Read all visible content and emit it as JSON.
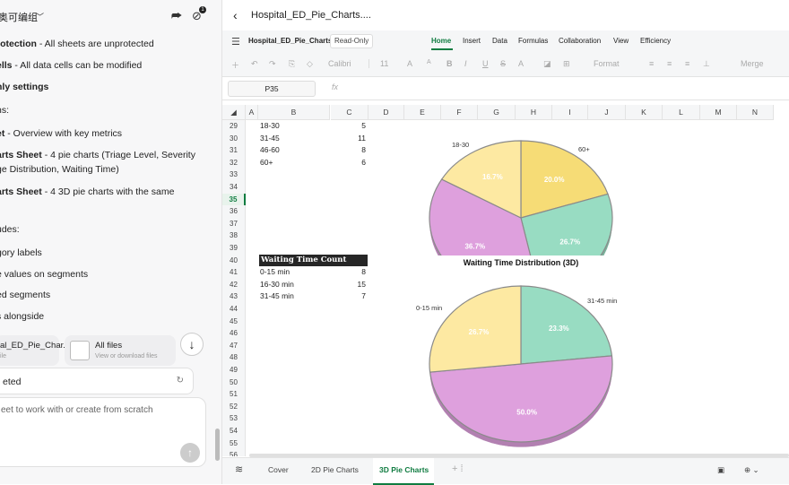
{
  "chat": {
    "title": "奥可编组",
    "title_caret": "﹀",
    "lines": [
      {
        "bold": "rotection",
        "rest": " - All sheets are unprotected"
      },
      {
        "bold": "ells",
        "rest": " - All data cells can be modified"
      },
      {
        "bold": "nly settings",
        "rest": ""
      },
      {
        "bold": "",
        "rest": "ns:"
      },
      {
        "bold": "et",
        "rest": " - Overview with key metrics"
      },
      {
        "bold": "arts Sheet",
        "rest": " - 4 pie charts (Triage Level, Severity"
      },
      {
        "bold": "",
        "rest": "ge Distribution, Waiting Time)"
      },
      {
        "bold": "arts Sheet",
        "rest": " - 4 3D pie charts with the same"
      },
      {
        "bold": "",
        "rest": "udes:"
      },
      {
        "bold": "",
        "rest": "gory labels"
      },
      {
        "bold": "",
        "rest": "e values on segments"
      },
      {
        "bold": "",
        "rest": "ed segments"
      },
      {
        "bold": "",
        "rest": "s alongside"
      }
    ],
    "file_chip_name": "al_ED_Pie_Char...",
    "file_chip_sub": "ile",
    "all_files_label": "All files",
    "all_files_sub": "View or download files",
    "completed_label": "eted",
    "composer_placeholder": "eet to work with or create from scratch"
  },
  "sheet": {
    "file_title": "Hospital_ED_Pie_Charts....",
    "workbook_name": "Hospital_ED_Pie_Charts",
    "read_only": "Read-Only",
    "tabs": [
      "Home",
      "Insert",
      "Data",
      "Formulas",
      "Collaboration",
      "View",
      "Efficiency"
    ],
    "toolbar": {
      "font": "Calibri",
      "size": "11",
      "format": "Format",
      "merge": "Merge"
    },
    "name_box": "P35",
    "fx": "fx",
    "columns": [
      "A",
      "B",
      "C",
      "D",
      "E",
      "F",
      "G",
      "H",
      "I",
      "J",
      "K",
      "L",
      "M",
      "N"
    ],
    "rows": [
      "29",
      "30",
      "31",
      "32",
      "33",
      "34",
      "35",
      "36",
      "37",
      "38",
      "39",
      "40",
      "41",
      "42",
      "43",
      "44",
      "45",
      "46",
      "47",
      "48",
      "49",
      "50",
      "51",
      "52",
      "53",
      "54",
      "55",
      "56"
    ],
    "selected_row": "35",
    "age_rows": [
      {
        "label": "18-30",
        "value": "5"
      },
      {
        "label": "31-45",
        "value": "11"
      },
      {
        "label": "46-60",
        "value": "8"
      },
      {
        "label": "60+",
        "value": "6"
      }
    ],
    "waiting_header": "Waiting Time Count",
    "waiting_rows": [
      {
        "label": "0-15 min",
        "value": "8"
      },
      {
        "label": "16-30 min",
        "value": "15"
      },
      {
        "label": "31-45 min",
        "value": "7"
      }
    ],
    "sheet_tabs": [
      "Cover",
      "2D Pie Charts",
      "3D Pie Charts"
    ],
    "active_sheet": "3D Pie Charts"
  },
  "chart_data": [
    {
      "type": "pie",
      "title": "",
      "categories": [
        "18-30",
        "31-45",
        "46-60",
        "60+"
      ],
      "values": [
        5,
        11,
        8,
        6
      ],
      "percent_labels": [
        "16.7%",
        "36.7%",
        "26.7%",
        "20.0%"
      ],
      "colors": [
        "#fde9a2",
        "#dea0dd",
        "#98dcc2",
        "#f6dc76"
      ],
      "visible_category_labels": [
        "18-30",
        "60+"
      ]
    },
    {
      "type": "pie",
      "title": "Waiting Time Distribution (3D)",
      "categories": [
        "0-15 min",
        "16-30 min",
        "31-45 min"
      ],
      "values": [
        8,
        15,
        7
      ],
      "percent_labels": [
        "26.7%",
        "50.0%",
        "23.3%"
      ],
      "colors": [
        "#fde9a2",
        "#dea0dd",
        "#98dcc2"
      ],
      "visible_category_labels": [
        "0-15 min",
        "31-45 min"
      ]
    }
  ]
}
